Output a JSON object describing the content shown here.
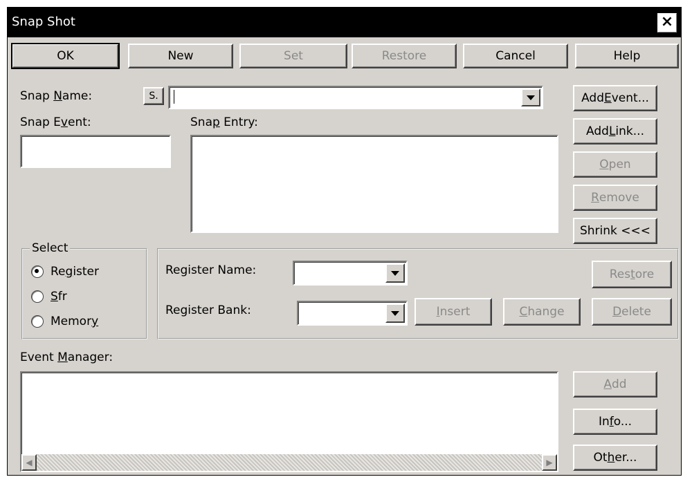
{
  "window": {
    "title": "Snap Shot",
    "close_glyph": "×"
  },
  "top_buttons": {
    "ok": "OK",
    "new": "New",
    "set": "Set",
    "restore": "Restore",
    "cancel": "Cancel",
    "help": "Help"
  },
  "snap_name": {
    "label_pre": "Snap ",
    "label_key": "N",
    "label_post": "ame:",
    "s_badge": "S.",
    "value": ""
  },
  "snap_event": {
    "label_pre": "Snap E",
    "label_key": "v",
    "label_post": "ent:",
    "value": ""
  },
  "snap_entry": {
    "label_pre": "Sna",
    "label_key": "p",
    "label_post": " Entry:"
  },
  "right_buttons": {
    "add_event": {
      "pre": "Add ",
      "key": "E",
      "post": "vent..."
    },
    "add_link": {
      "pre": "Add ",
      "key": "L",
      "post": "ink..."
    },
    "open": {
      "pre": "",
      "key": "O",
      "post": "pen"
    },
    "remove": {
      "pre": "",
      "key": "R",
      "post": "emove"
    },
    "shrink": "Shrink <<<"
  },
  "select_group": {
    "title": "Select",
    "options": [
      {
        "pre": "Re",
        "key": "g",
        "post": "ister",
        "selected": true
      },
      {
        "pre": "",
        "key": "S",
        "post": "fr",
        "selected": false
      },
      {
        "pre": "Memor",
        "key": "y",
        "post": "",
        "selected": false
      }
    ]
  },
  "register_panel": {
    "name_label": "Register Name:",
    "bank_label": "Register Bank:",
    "name_value": "",
    "bank_value": "",
    "insert": {
      "pre": "",
      "key": "I",
      "post": "nsert"
    },
    "change": {
      "pre": "",
      "key": "C",
      "post": "hange"
    },
    "restore": {
      "pre": "Res",
      "key": "t",
      "post": "ore"
    },
    "delete": {
      "pre": "",
      "key": "D",
      "post": "elete"
    }
  },
  "event_manager": {
    "label_pre": "Event ",
    "label_key": "M",
    "label_post": "anager:",
    "add": {
      "pre": "",
      "key": "A",
      "post": "dd"
    },
    "info": {
      "pre": "In",
      "key": "f",
      "post": "o..."
    },
    "other": {
      "pre": "Ot",
      "key": "h",
      "post": "er..."
    },
    "scroll_left": "◀",
    "scroll_right": "▶"
  },
  "icons": {
    "dropdown": "chevron-down-icon",
    "close": "close-icon"
  }
}
